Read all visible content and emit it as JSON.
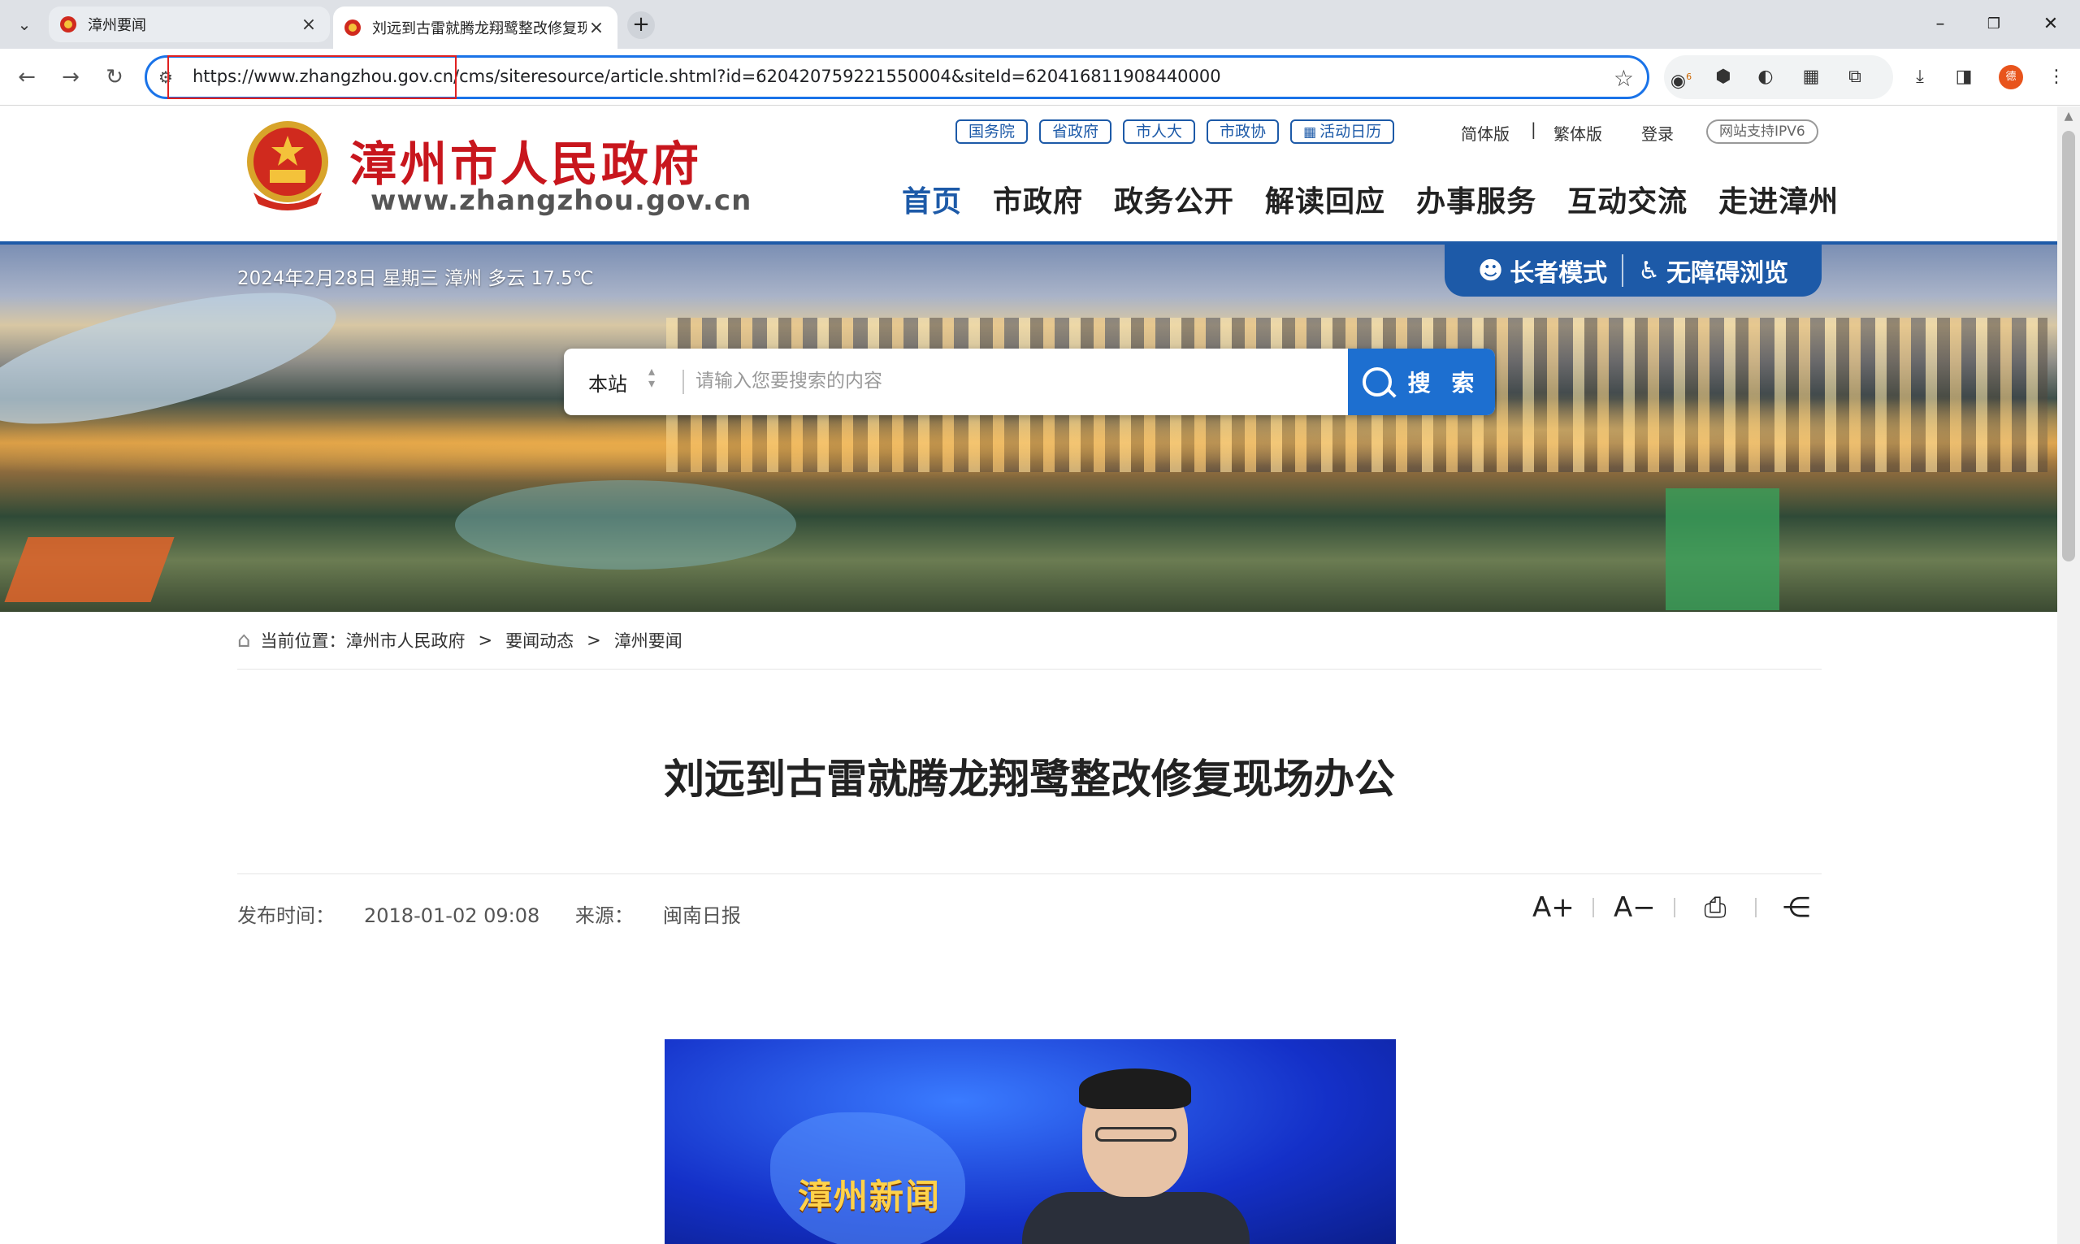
{
  "browser": {
    "tabs": [
      {
        "title": "漳州要闻",
        "active": false
      },
      {
        "title": "刘远到古雷就腾龙翔鹭整改修复现场办公",
        "active": true
      }
    ],
    "url": "https://www.zhangzhou.gov.cn/cms/siteresource/article.shtml?id=620420759221550004&siteId=620416811908440000",
    "extension_badge": "6",
    "profile_initial": "德"
  },
  "header": {
    "site_name": "漳州市人民政府",
    "site_domain": "www.zhangzhou.gov.cn",
    "top_links": [
      "国务院",
      "省政府",
      "市人大",
      "市政协"
    ],
    "calendar_link": "活动日历",
    "lang_simplified": "简体版",
    "lang_separator": "|",
    "lang_traditional": "繁体版",
    "login": "登录",
    "ipv6": "网站支持IPV6",
    "nav": [
      "首页",
      "市政府",
      "政务公开",
      "解读回应",
      "办事服务",
      "互动交流",
      "走进漳州"
    ]
  },
  "banner": {
    "date_weather": "2024年2月28日 星期三 漳州 多云 17.5℃",
    "elder_mode": "长者模式",
    "accessible": "无障碍浏览",
    "search_scope": "本站",
    "search_placeholder": "请输入您要搜索的内容",
    "search_button": "搜 索"
  },
  "breadcrumb": {
    "prefix": "当前位置：",
    "items": [
      "漳州市人民政府",
      "要闻动态",
      "漳州要闻"
    ],
    "separator": ">"
  },
  "article": {
    "title": "刘远到古雷就腾龙翔鹭整改修复现场办公",
    "publish_label": "发布时间：",
    "publish_time": "2018-01-02 09:08",
    "source_label": "来源：",
    "source": "闽南日报",
    "tools": {
      "font_up": "A+",
      "font_down": "A−"
    },
    "video_overlay": "漳州新闻"
  },
  "colors": {
    "brand_blue": "#1d5aa8",
    "brand_red": "#c8161d",
    "search_blue": "#1d6fd0"
  }
}
